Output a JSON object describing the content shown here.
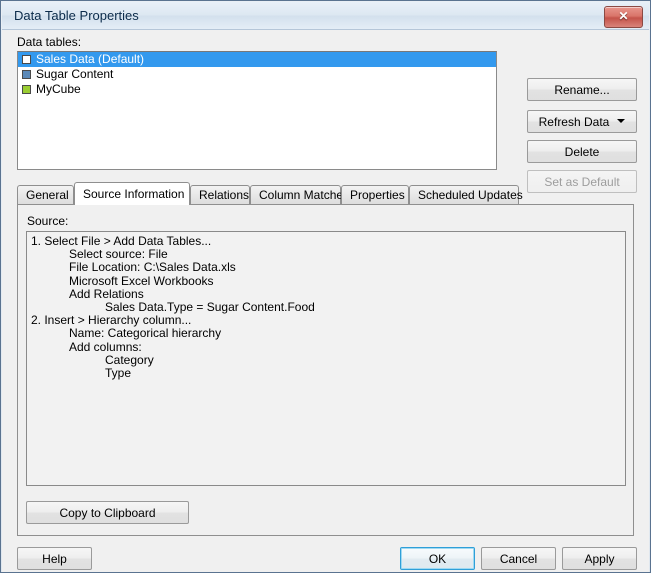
{
  "window": {
    "title": "Data Table Properties",
    "close_icon": "close-x-icon",
    "close_label": "✖"
  },
  "data_tables": {
    "label": "Data tables:",
    "items": [
      {
        "label": "Sales Data (Default)",
        "icon": "table-square-icon",
        "color": "#ffffff",
        "selected": true
      },
      {
        "label": "Sugar Content",
        "icon": "table-square-icon",
        "color": "#5b89b8",
        "selected": false
      },
      {
        "label": "MyCube",
        "icon": "cube-square-icon",
        "color": "#9acd32",
        "selected": false
      }
    ]
  },
  "side_buttons": {
    "rename": "Rename...",
    "refresh_data": "Refresh Data",
    "delete": "Delete",
    "set_as_default": "Set as Default"
  },
  "tabs": [
    {
      "label": "General",
      "active": false
    },
    {
      "label": "Source Information",
      "active": true
    },
    {
      "label": "Relations",
      "active": false
    },
    {
      "label": "Column Matches",
      "active": false
    },
    {
      "label": "Properties",
      "active": false
    },
    {
      "label": "Scheduled Updates",
      "active": false
    }
  ],
  "source": {
    "label": "Source:",
    "lines": [
      {
        "text": "1. Select File > Add Data Tables...",
        "indent": 0
      },
      {
        "text": "Select source: File",
        "indent": 1
      },
      {
        "text": "File Location: C:\\Sales Data.xls",
        "indent": 1
      },
      {
        "text": "Microsoft Excel Workbooks",
        "indent": 1
      },
      {
        "text": "Add Relations",
        "indent": 1
      },
      {
        "text": "Sales Data.Type = Sugar Content.Food",
        "indent": 2
      },
      {
        "text": "2. Insert > Hierarchy column...",
        "indent": 0
      },
      {
        "text": "Name: Categorical hierarchy",
        "indent": 1
      },
      {
        "text": "Add columns:",
        "indent": 1
      },
      {
        "text": "Category",
        "indent": 2
      },
      {
        "text": "Type",
        "indent": 2
      }
    ],
    "copy_to_clipboard": "Copy to Clipboard"
  },
  "footer": {
    "help": "Help",
    "ok": "OK",
    "cancel": "Cancel",
    "apply": "Apply"
  },
  "colors": {
    "selection": "#3399ee",
    "title_text": "#0b2b4a",
    "default_button_border": "#2f9fd8",
    "close_button": "#c4534a"
  }
}
